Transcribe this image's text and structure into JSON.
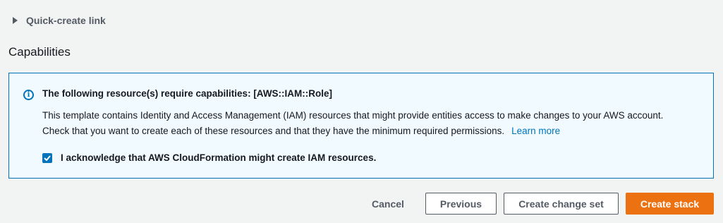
{
  "quick_create": {
    "label": "Quick-create link",
    "icon": "caret-right-icon",
    "expanded": false
  },
  "capabilities": {
    "heading": "Capabilities",
    "alert": {
      "icon": "info-icon",
      "icon_glyph": "i",
      "title": "The following resource(s) require capabilities: [AWS::IAM::Role]",
      "body_line_1": "This template contains Identity and Access Management (IAM) resources that might provide entities access to make changes to your AWS account.",
      "body_line_2": "Check that you want to create each of these resources and that they have the minimum required permissions.",
      "learn_more": "Learn more",
      "accent_color": "#0073bb",
      "background_color": "#f1faff"
    },
    "acknowledge": {
      "checked": true,
      "label": "I acknowledge that AWS CloudFormation might create IAM resources."
    }
  },
  "footer": {
    "cancel_label": "Cancel",
    "previous_label": "Previous",
    "create_change_set_label": "Create change set",
    "create_stack_label": "Create stack",
    "primary_color": "#ec7211"
  }
}
